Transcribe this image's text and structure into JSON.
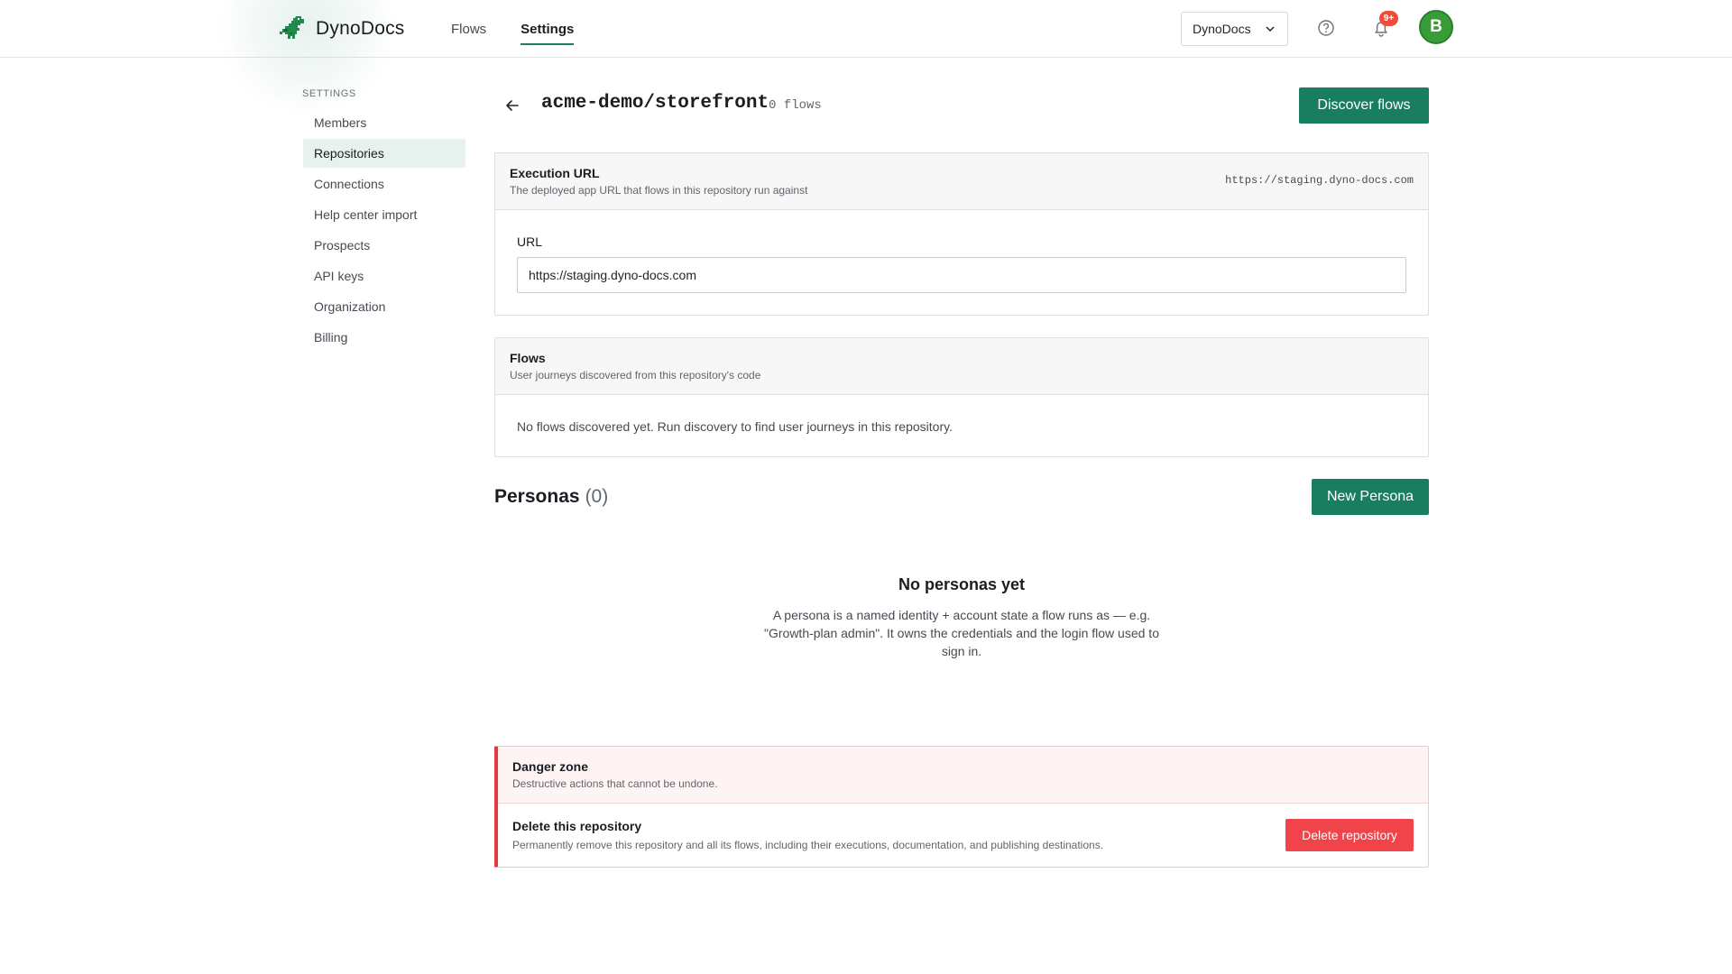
{
  "app": {
    "brand": "DynoDocs",
    "brand_icon": "dinosaur-logo-icon"
  },
  "nav": {
    "items": [
      {
        "label": "Flows"
      },
      {
        "label": "Settings",
        "active": true
      }
    ]
  },
  "header_right": {
    "org_selector": "DynoDocs",
    "notification_badge": "9+",
    "avatar_initial": "B"
  },
  "sidebar": {
    "heading": "SETTINGS",
    "items": [
      {
        "label": "Members"
      },
      {
        "label": "Repositories",
        "active": true
      },
      {
        "label": "Connections"
      },
      {
        "label": "Help center import"
      },
      {
        "label": "Prospects"
      },
      {
        "label": "API keys"
      },
      {
        "label": "Organization"
      },
      {
        "label": "Billing"
      }
    ]
  },
  "repo": {
    "title": "acme-demo/storefront",
    "flow_count": "0 flows",
    "discover_button": "Discover flows"
  },
  "execution": {
    "title": "Execution URL",
    "subtitle": "The deployed app URL that flows in this repository run against",
    "current_url": "https://staging.dyno-docs.com",
    "url_label": "URL",
    "url_value": "https://staging.dyno-docs.com"
  },
  "flows": {
    "title": "Flows",
    "subtitle": "User journeys discovered from this repository's code",
    "empty_text": "No flows discovered yet. Run discovery to find user journeys in this repository."
  },
  "personas": {
    "title": "Personas",
    "count": "(0)",
    "new_button": "New Persona",
    "empty_title": "No personas yet",
    "empty_desc": "A persona is a named identity + account state a flow runs as — e.g. \"Growth-plan admin\". It owns the credentials and the login flow used to sign in."
  },
  "danger": {
    "title": "Danger zone",
    "subtitle": "Destructive actions that cannot be undone.",
    "row_title": "Delete this repository",
    "row_desc": "Permanently remove this repository and all its flows, including their executions, documentation, and publishing destinations.",
    "button": "Delete repository"
  },
  "colors": {
    "primary": "#187e5f",
    "danger": "#f1434a",
    "badge": "#f14b3a",
    "avatar": "#3a9c39"
  }
}
